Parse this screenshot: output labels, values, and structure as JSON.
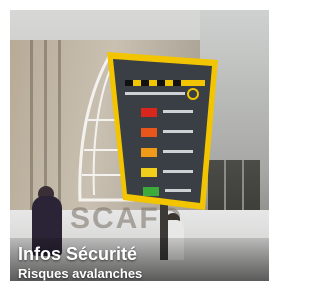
{
  "card": {
    "title": "Infos Sécurité",
    "subtitle": "Risques avalanches"
  },
  "photo": {
    "subject": "avalanche-risk-sign-photo",
    "sign_frame_color": "#f2c500",
    "sign_body_color": "#3a3f45",
    "risk_level_colors": [
      "#d9261c",
      "#e8561c",
      "#f09a1a",
      "#f2cf1a",
      "#3cab3a"
    ]
  }
}
